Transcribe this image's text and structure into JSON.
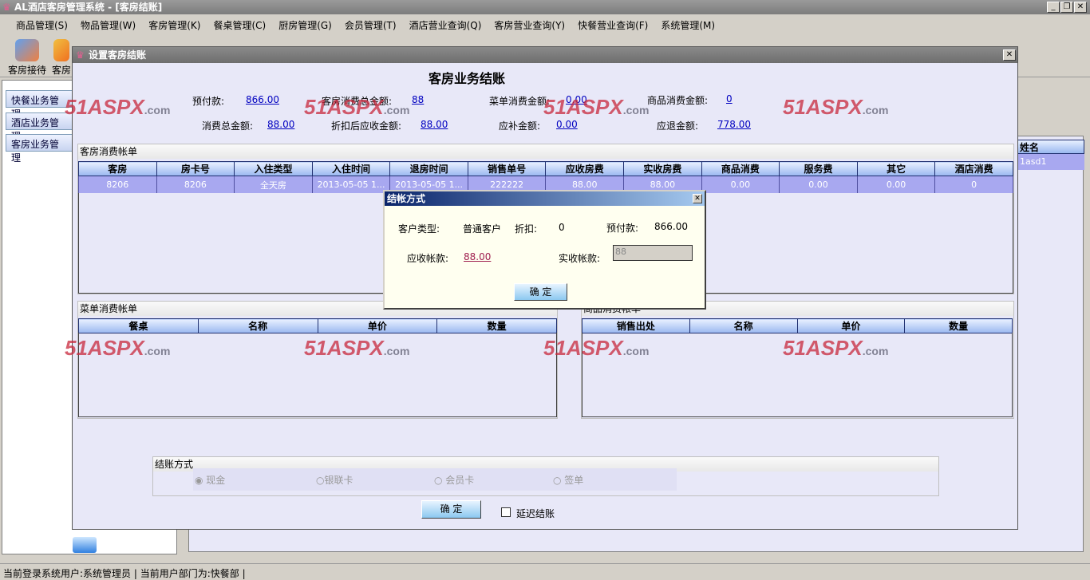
{
  "app": {
    "title": "AL酒店客房管理系统 - [客房结账]"
  },
  "menu": [
    "商品管理(S)",
    "物品管理(W)",
    "客房管理(K)",
    "餐桌管理(C)",
    "厨房管理(G)",
    "会员管理(T)",
    "酒店营业查询(Q)",
    "客房营业查询(Y)",
    "快餐营业查询(F)",
    "系统管理(M)"
  ],
  "toolbar": {
    "items": [
      "客房接待",
      "客房"
    ]
  },
  "sidebar": {
    "items": [
      "快餐业务管理",
      "酒店业务管理",
      "客房业务管理"
    ]
  },
  "right": {
    "header": "姓名",
    "cell": "1asd1"
  },
  "dialog": {
    "title": "设置客房结账",
    "heading": "客房业务结账",
    "summary": {
      "prepay_label": "预付款:",
      "prepay": "866.00",
      "room_total_label": "客房消费总金额:",
      "room_total": "88",
      "menu_total_label": "菜单消费金额:",
      "menu_total": "0.00",
      "goods_total_label": "商品消费金额:",
      "goods_total": "0",
      "total_label": "消费总金额:",
      "total": "88.00",
      "discounted_label": "折扣后应收金额:",
      "discounted": "88.00",
      "supplement_label": "应补金额:",
      "supplement": "0.00",
      "refund_label": "应退金额:",
      "refund": "778.00"
    },
    "room_bill": {
      "title": "客房消费帐单",
      "columns": [
        "客房",
        "房卡号",
        "入住类型",
        "入住时间",
        "退房时间",
        "销售单号",
        "应收房费",
        "实收房费",
        "商品消费",
        "服务费",
        "其它",
        "酒店消费"
      ],
      "rows": [
        [
          "8206",
          "8206",
          "全天房",
          "2013-05-05 1...",
          "2013-05-05 1...",
          "222222",
          "88.00",
          "88.00",
          "0.00",
          "0.00",
          "0.00",
          "0"
        ]
      ]
    },
    "menu_bill": {
      "title": "菜单消费帐单",
      "columns": [
        "餐桌",
        "名称",
        "单价",
        "数量"
      ]
    },
    "goods_bill": {
      "title": "商品消费帐单",
      "columns": [
        "销售出处",
        "名称",
        "单价",
        "数量"
      ]
    },
    "payment": {
      "title": "结账方式",
      "options": [
        "现金",
        "银联卡",
        "会员卡",
        "签单"
      ],
      "selected": "现金"
    },
    "ok": "确 定",
    "delay": "延迟结账"
  },
  "paydlg": {
    "title": "结帐方式",
    "cust_type_label": "客户类型:",
    "cust_type": "普通客户",
    "discount_label": "折扣:",
    "discount": "0",
    "prepay_label": "预付款:",
    "prepay": "866.00",
    "due_label": "应收帐款:",
    "due": "88.00",
    "received_label": "实收帐款:",
    "received": "88",
    "ok": "确 定"
  },
  "watermark": "51ASPX.com",
  "status": {
    "user_label": "当前登录系统用户:",
    "user": "系统管理员",
    "dept_label": "当前用户部门为:",
    "dept": "快餐部"
  }
}
